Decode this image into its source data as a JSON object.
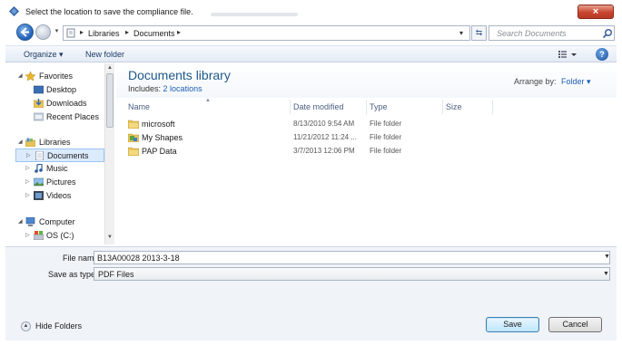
{
  "window": {
    "title": "Select the location to save the compliance file.",
    "close_label": "×"
  },
  "address": {
    "crumbs": [
      "Libraries",
      "Documents"
    ],
    "search_placeholder": "Search Documents"
  },
  "toolbar": {
    "organize_label": "Organize ▾",
    "new_folder_label": "New folder"
  },
  "nav": {
    "items": [
      {
        "label": "Favorites",
        "icon": "star-icon"
      },
      {
        "label": "Desktop",
        "icon": "desktop-icon"
      },
      {
        "label": "Downloads",
        "icon": "downloads-icon"
      },
      {
        "label": "Recent Places",
        "icon": "recent-places-icon"
      },
      {
        "label": "Libraries",
        "icon": "libraries-icon"
      },
      {
        "label": "Documents",
        "icon": "documents-icon"
      },
      {
        "label": "Music",
        "icon": "music-icon"
      },
      {
        "label": "Pictures",
        "icon": "pictures-icon"
      },
      {
        "label": "Videos",
        "icon": "videos-icon"
      },
      {
        "label": "Computer",
        "icon": "computer-icon"
      },
      {
        "label": "OS (C:)",
        "icon": "drive-icon"
      }
    ]
  },
  "library": {
    "title": "Documents library",
    "includes_label": "Includes:",
    "includes_link": "2 locations",
    "arrange_label": "Arrange by:",
    "arrange_value": "Folder ▾"
  },
  "columns": [
    "Name",
    "Date modified",
    "Type",
    "Size"
  ],
  "files": [
    {
      "name": "microsoft",
      "date": "8/13/2010 9:54 AM",
      "type": "File folder",
      "icon": "folder-icon"
    },
    {
      "name": "My Shapes",
      "date": "11/21/2012 11:24 ...",
      "type": "File folder",
      "icon": "shapes-folder-icon"
    },
    {
      "name": "PAP Data",
      "date": "3/7/2013 12:06 PM",
      "type": "File folder",
      "icon": "folder-icon"
    }
  ],
  "form": {
    "filename_label": "File name:",
    "filename_value": "B13A00028 2013-3-18",
    "savetype_label": "Save as type:",
    "savetype_value": "PDF Files",
    "hide_folders_label": "Hide Folders",
    "save_label": "Save",
    "cancel_label": "Cancel"
  }
}
